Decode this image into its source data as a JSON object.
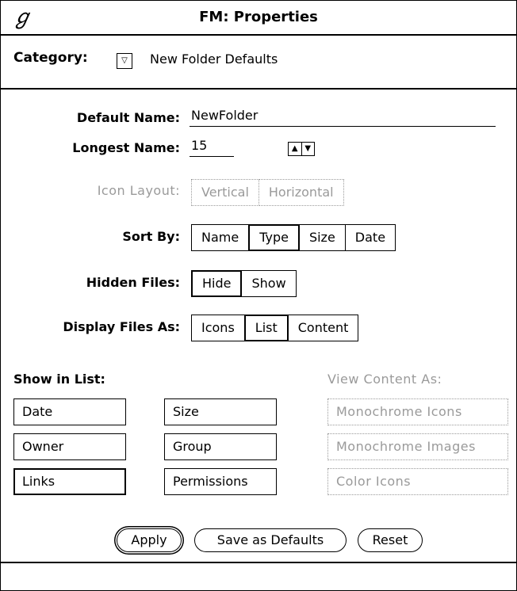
{
  "window": {
    "title": "FM: Properties",
    "menu_glyph": "ℊ"
  },
  "category": {
    "label": "Category:",
    "menu_glyph": "▽",
    "value": "New Folder Defaults"
  },
  "fields": {
    "default_name": {
      "label": "Default Name:",
      "value": "NewFolder"
    },
    "longest_name": {
      "label": "Longest Name:",
      "value": "15",
      "up_glyph": "▲",
      "down_glyph": "▼"
    }
  },
  "icon_layout": {
    "label": "Icon Layout:",
    "options": [
      "Vertical",
      "Horizontal"
    ]
  },
  "sort_by": {
    "label": "Sort By:",
    "options": [
      "Name",
      "Type",
      "Size",
      "Date"
    ],
    "selected": "Type"
  },
  "hidden_files": {
    "label": "Hidden Files:",
    "options": [
      "Hide",
      "Show"
    ],
    "selected": "Hide"
  },
  "display_as": {
    "label": "Display Files As:",
    "options": [
      "Icons",
      "List",
      "Content"
    ],
    "selected": "List"
  },
  "show_in_list": {
    "label": "Show in List:",
    "items": [
      "Date",
      "Size",
      "Owner",
      "Group",
      "Links",
      "Permissions"
    ],
    "selected": "Links"
  },
  "view_content": {
    "label": "View Content As:",
    "items": [
      "Monochrome Icons",
      "Monochrome Images",
      "Color Icons"
    ]
  },
  "buttons": {
    "apply": "Apply",
    "save_defaults": "Save as Defaults",
    "reset": "Reset"
  },
  "colors": {
    "disabled": "#9a9a9a",
    "border": "#000000"
  }
}
